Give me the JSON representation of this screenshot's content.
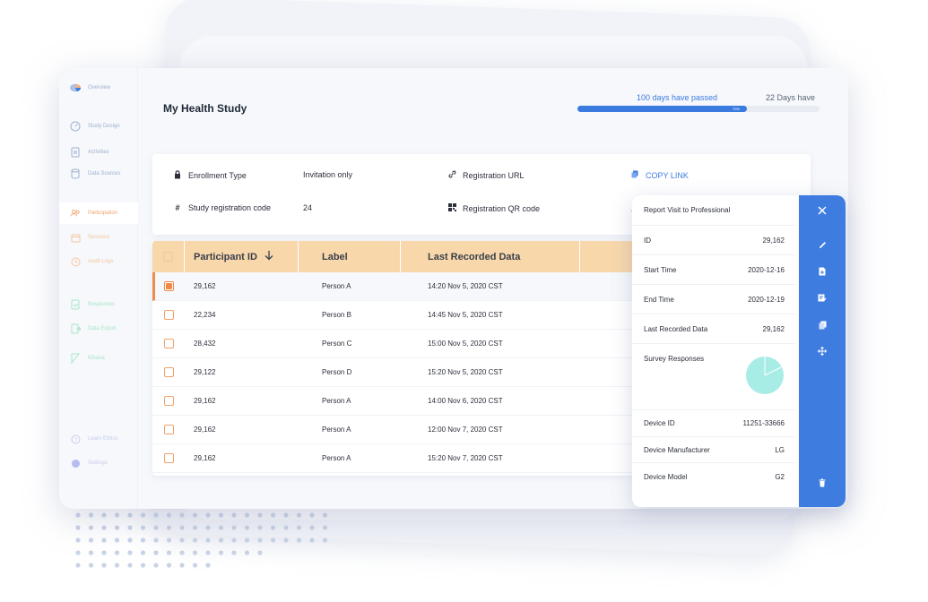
{
  "sidebar": {
    "items": [
      {
        "label": "Overview",
        "icon": "pie-icon"
      },
      {
        "label": "Study Design",
        "icon": "gauge-icon"
      },
      {
        "label": "Activities",
        "icon": "clipboard-icon"
      },
      {
        "label": "Data Sources",
        "icon": "database-icon"
      },
      {
        "label": "Participation",
        "icon": "users-icon"
      },
      {
        "label": "Sessions",
        "icon": "calendar-icon"
      },
      {
        "label": "Audit Logs",
        "icon": "history-icon"
      },
      {
        "label": "Responses",
        "icon": "file-check-icon"
      },
      {
        "label": "Data Export",
        "icon": "export-icon"
      },
      {
        "label": "Kibana",
        "icon": "kibana-icon"
      },
      {
        "label": "Learn Ethics",
        "icon": "help-icon"
      },
      {
        "label": "Settings",
        "icon": "settings-dot-icon"
      }
    ]
  },
  "header": {
    "title": "My Health Study",
    "progress": {
      "passed_label": "100 days have passed",
      "remaining_label": "22 Days have",
      "percent": 0.7,
      "percent_label": "70%"
    }
  },
  "info": {
    "enrollment_type_label": "Enrollment Type",
    "enrollment_type_value": "Invitation only",
    "registration_url_label": "Registration URL",
    "copy_link_label": "COPY LINK",
    "registration_code_label": "Study registration code",
    "registration_code_value": "24",
    "qr_code_label": "Registration QR code"
  },
  "table": {
    "columns": [
      "Participant ID",
      "Label",
      "Last Recorded Data"
    ],
    "rows": [
      {
        "id": "29,162",
        "label": "Person A",
        "last": "14:20 Nov 5, 2020 CST",
        "checked": true
      },
      {
        "id": "22,234",
        "label": "Person B",
        "last": "14:45 Nov 5, 2020 CST",
        "checked": false
      },
      {
        "id": "28,432",
        "label": "Person C",
        "last": "15:00 Nov 5, 2020 CST",
        "checked": false
      },
      {
        "id": "29,122",
        "label": "Person D",
        "last": "15:20 Nov 5, 2020 CST",
        "checked": false
      },
      {
        "id": "29,162",
        "label": "Person A",
        "last": "14:00 Nov 6, 2020 CST",
        "checked": false
      },
      {
        "id": "29,162",
        "label": "Person A",
        "last": "12:00 Nov 7, 2020 CST",
        "checked": false
      },
      {
        "id": "29,162",
        "label": "Person A",
        "last": "15:20 Nov 7, 2020 CST",
        "checked": false
      }
    ]
  },
  "detail": {
    "title": "Report Visit to Professional",
    "fields": [
      {
        "label": "ID",
        "value": "29,162"
      },
      {
        "label": "Start Time",
        "value": "2020-12-16"
      },
      {
        "label": "End Time",
        "value": "2020-12-19"
      },
      {
        "label": "Last Recorded Data",
        "value": "29,162"
      },
      {
        "label": "Survey Responses",
        "value": ""
      },
      {
        "label": "Device ID",
        "value": "11251-33666"
      },
      {
        "label": "Device Manufacturer",
        "value": "LG"
      },
      {
        "label": "Device Model",
        "value": "G2"
      }
    ],
    "survey_chart_color": "#a8ece6"
  },
  "colors": {
    "accent": "#3f7ce0",
    "orange": "#f08a4b",
    "header_bg": "#f8d7aa"
  }
}
